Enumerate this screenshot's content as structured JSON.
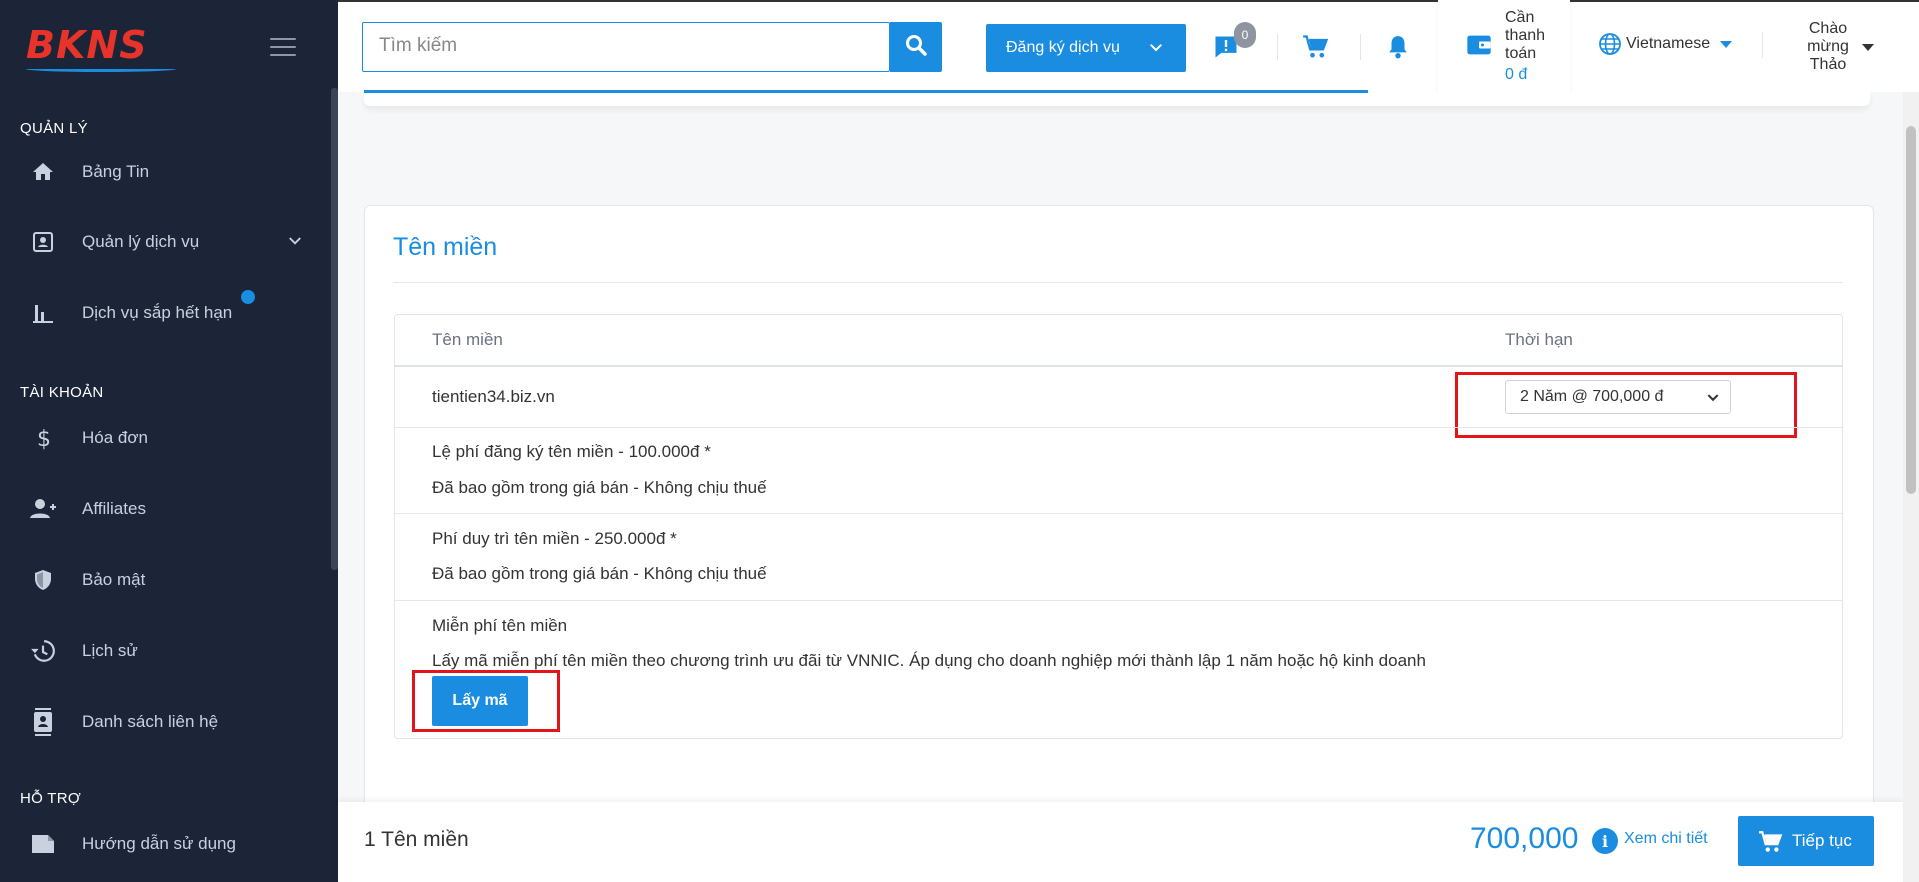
{
  "brand": {
    "logo_text": "BKNS"
  },
  "sidebar": {
    "sections": [
      {
        "title": "QUẢN LÝ"
      },
      {
        "title": "TÀI KHOẢN"
      },
      {
        "title": "HỖ TRỢ"
      }
    ],
    "items": [
      {
        "label": "Bảng Tin",
        "icon": "home-icon"
      },
      {
        "label": "Quản lý dịch vụ",
        "icon": "contact-card-icon"
      },
      {
        "label": "Dịch vụ sắp hết hạn",
        "icon": "bar-chart-icon"
      },
      {
        "label": "Hóa đơn",
        "icon": "dollar-icon"
      },
      {
        "label": "Affiliates",
        "icon": "add-user-icon"
      },
      {
        "label": "Bảo mật",
        "icon": "shield-icon"
      },
      {
        "label": "Lịch sử",
        "icon": "history-icon"
      },
      {
        "label": "Danh sách liên hệ",
        "icon": "contacts-icon"
      },
      {
        "label": "Hướng dẫn sử dụng",
        "icon": "document-icon"
      }
    ]
  },
  "header": {
    "search_placeholder": "Tìm kiếm",
    "register_service_label": "Đăng ký dịch vụ",
    "message_badge": "0",
    "wallet_label": "Cần thanh toán",
    "wallet_amount": "0 đ",
    "language": "Vietnamese",
    "greeting": "Chào mừng Thảo"
  },
  "domain_card": {
    "title": "Tên miền",
    "columns": {
      "domain": "Tên miền",
      "term": "Thời hạn"
    },
    "domain_name": "tientien34.biz.vn",
    "term_selected": "2 Năm @ 700,000 đ",
    "fees": [
      {
        "title": "Lệ phí đăng ký tên miền - 100.000đ *",
        "note": "Đã bao gồm trong giá bán - Không chịu thuế"
      },
      {
        "title": "Phí duy trì tên miền - 250.000đ *",
        "note": "Đã bao gồm trong giá bán - Không chịu thuế"
      }
    ],
    "free_domain_title": "Miễn phí tên miền",
    "free_domain_desc": "Lấy mã miễn phí tên miền theo chương trình ưu đãi từ VNNIC. Áp dụng cho doanh nghiệp mới thành lập 1 năm hoặc hộ kinh doanh",
    "get_code_label": "Lấy mã"
  },
  "footer": {
    "count_label": "1 Tên miền",
    "total": "700,000",
    "info_glyph": "i",
    "detail_label": "Xem chi tiết",
    "continue_label": "Tiếp tục"
  },
  "colors": {
    "sidebar_bg": "#1b2537",
    "accent": "#1a8de0",
    "highlight_red": "#e3151a",
    "logo_red": "#e8332b"
  }
}
